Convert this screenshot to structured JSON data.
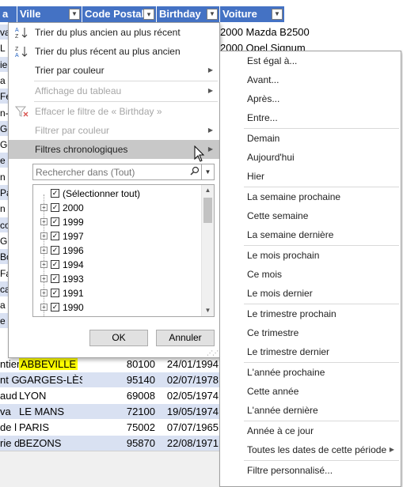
{
  "table": {
    "headers": [
      {
        "label": "Ville",
        "filtered": false
      },
      {
        "label": "Code Postal",
        "filtered": false
      },
      {
        "label": "Birthday",
        "filtered": true
      },
      {
        "label": "Voiture",
        "filtered": false
      }
    ],
    "header_col0_fragment": "a",
    "left_fragments": [
      "va",
      "L",
      "ie",
      "a",
      "Fe",
      "n-",
      "Ge",
      "Gé",
      "e",
      "n C",
      "Pa",
      "n C",
      "co",
      "Gu",
      "Bo",
      "Fa",
      "ca",
      "a C",
      "e D"
    ],
    "car_values": [
      "2000 Mazda B2500",
      "2000 Opel Signum"
    ],
    "rows": [
      {
        "a": "ntier",
        "ville": "ABBEVILLE",
        "ville_highlight": true,
        "cp": "80100",
        "birthday": "24/01/1994",
        "band": false
      },
      {
        "a": "nt G",
        "ville": "GARGES-LÈS-",
        "ville_highlight": false,
        "cp": "95140",
        "birthday": "02/07/1978",
        "band": true
      },
      {
        "a": "aud",
        "ville": "LYON",
        "ville_highlight": false,
        "cp": "69008",
        "birthday": "02/05/1974",
        "band": false
      },
      {
        "a": "va",
        "ville": "LE MANS",
        "ville_highlight": false,
        "cp": "72100",
        "birthday": "19/05/1974",
        "band": true
      },
      {
        "a": "de l",
        "ville": "PARIS",
        "ville_highlight": false,
        "cp": "75002",
        "birthday": "07/07/1965",
        "band": false
      },
      {
        "a": "rie d",
        "ville": "BEZONS",
        "ville_highlight": false,
        "cp": "95870",
        "birthday": "22/08/1971",
        "band": true
      }
    ],
    "highlight_color": "#ffff00",
    "header_color": "#4472c4",
    "band_color": "#d9e1f2"
  },
  "filter_menu": {
    "sort_oldest": "Trier du plus ancien au plus récent",
    "sort_newest": "Trier du plus récent au plus ancien",
    "sort_by_color": "Trier par couleur",
    "sheet_view": "Affichage du tableau",
    "clear_filter": "Effacer le filtre de « Birthday »",
    "filter_by_color": "Filtrer par couleur",
    "date_filters": "Filtres chronologiques",
    "search_placeholder": "Rechercher dans (Tout)",
    "select_all": "(Sélectionner tout)",
    "years": [
      "2000",
      "1999",
      "1997",
      "1996",
      "1994",
      "1993",
      "1991",
      "1990"
    ],
    "ok": "OK",
    "cancel": "Annuler"
  },
  "date_submenu": {
    "items": [
      {
        "label": "Est égal à...",
        "group": 0
      },
      {
        "label": "Avant...",
        "group": 0
      },
      {
        "label": "Après...",
        "group": 0
      },
      {
        "label": "Entre...",
        "group": 0
      },
      {
        "label": "Demain",
        "group": 1
      },
      {
        "label": "Aujourd'hui",
        "group": 1
      },
      {
        "label": "Hier",
        "group": 1
      },
      {
        "label": "La semaine prochaine",
        "group": 2
      },
      {
        "label": "Cette semaine",
        "group": 2
      },
      {
        "label": "La semaine dernière",
        "group": 2
      },
      {
        "label": "Le mois prochain",
        "group": 3
      },
      {
        "label": "Ce mois",
        "group": 3
      },
      {
        "label": "Le mois dernier",
        "group": 3
      },
      {
        "label": "Le trimestre prochain",
        "group": 4
      },
      {
        "label": "Ce trimestre",
        "group": 4
      },
      {
        "label": "Le trimestre dernier",
        "group": 4
      },
      {
        "label": "L'année prochaine",
        "group": 5
      },
      {
        "label": "Cette année",
        "group": 5
      },
      {
        "label": "L'année dernière",
        "group": 5
      },
      {
        "label": "Année à ce jour",
        "group": 6
      },
      {
        "label": "Toutes les dates de cette période",
        "group": 6,
        "has_submenu": true
      },
      {
        "label": "Filtre personnalisé...",
        "group": 7
      }
    ]
  }
}
